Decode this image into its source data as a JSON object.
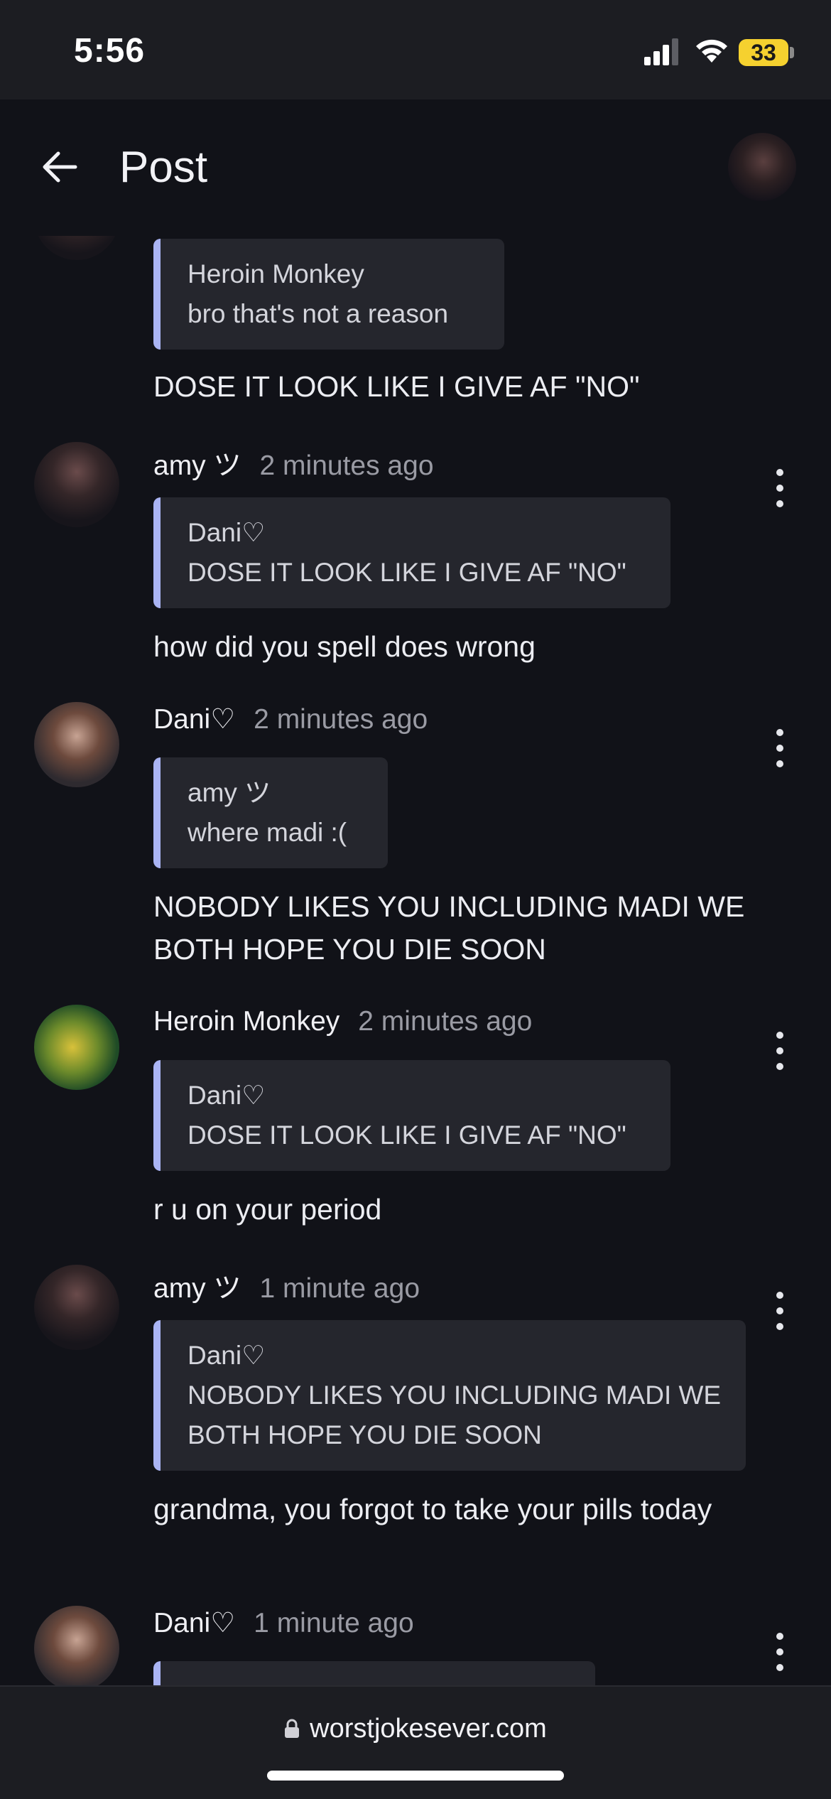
{
  "status_bar": {
    "time": "5:56",
    "battery": "33"
  },
  "header": {
    "title": "Post"
  },
  "comments": [
    {
      "quote_author": "Heroin Monkey",
      "quote_text": "bro that's not a reason",
      "text": "DOSE IT LOOK LIKE I GIVE AF \"NO\""
    },
    {
      "author": "amy ツ",
      "time": "2 minutes ago",
      "quote_author": "Dani♡",
      "quote_text": "DOSE IT LOOK LIKE I GIVE AF \"NO\"",
      "text": "how did you spell does wrong"
    },
    {
      "author": "Dani♡",
      "time": "2 minutes ago",
      "quote_author": "amy ツ",
      "quote_text": "where madi :(",
      "text": "NOBODY LIKES YOU INCLUDING MADI WE BOTH HOPE YOU DIE SOON"
    },
    {
      "author": "Heroin Monkey",
      "time": "2 minutes ago",
      "quote_author": "Dani♡",
      "quote_text": "DOSE IT LOOK LIKE I GIVE AF \"NO\"",
      "text": "r u on your period"
    },
    {
      "author": "amy ツ",
      "time": "1 minute ago",
      "quote_author": "Dani♡",
      "quote_text": "NOBODY LIKES YOU INCLUDING MADI WE BOTH HOPE YOU DIE SOON",
      "text": "grandma, you forgot to take your pills today"
    },
    {
      "author": "Dani♡",
      "time": "1 minute ago"
    }
  ],
  "bottom_bar": {
    "url": "worstjokesever.com"
  }
}
